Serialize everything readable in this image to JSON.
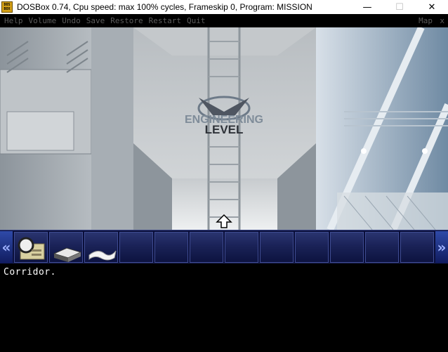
{
  "window": {
    "title": "DOSBox 0.74, Cpu speed: max 100% cycles, Frameskip  0, Program:  MISSION",
    "icon_label_top": "DOS",
    "icon_label_bottom": "BOX",
    "icon": "dosbox-icon",
    "controls": {
      "minimize": "—",
      "maximize": "☐",
      "close": "✕"
    }
  },
  "menu": {
    "items": [
      "Help",
      "Volume",
      "Undo",
      "Save",
      "Restore",
      "Restart",
      "Quit"
    ],
    "map_label": "Map",
    "close_label": "x",
    "text_color": "#5c5c5c"
  },
  "scene": {
    "sign_line1": "ENGINEERING",
    "sign_line2": "LEVEL",
    "cursor_icon": "up-arrow-icon"
  },
  "inventory": {
    "scroll_left_icon": "double-chevron-left-icon",
    "scroll_right_icon": "double-chevron-right-icon",
    "slots": [
      {
        "item": "id-card-icon"
      },
      {
        "item": "book-icon"
      },
      {
        "item": "paper-icon"
      },
      {
        "item": ""
      },
      {
        "item": ""
      },
      {
        "item": ""
      },
      {
        "item": ""
      },
      {
        "item": ""
      },
      {
        "item": ""
      },
      {
        "item": ""
      },
      {
        "item": ""
      },
      {
        "item": ""
      }
    ]
  },
  "description": {
    "text": "Corridor."
  }
}
